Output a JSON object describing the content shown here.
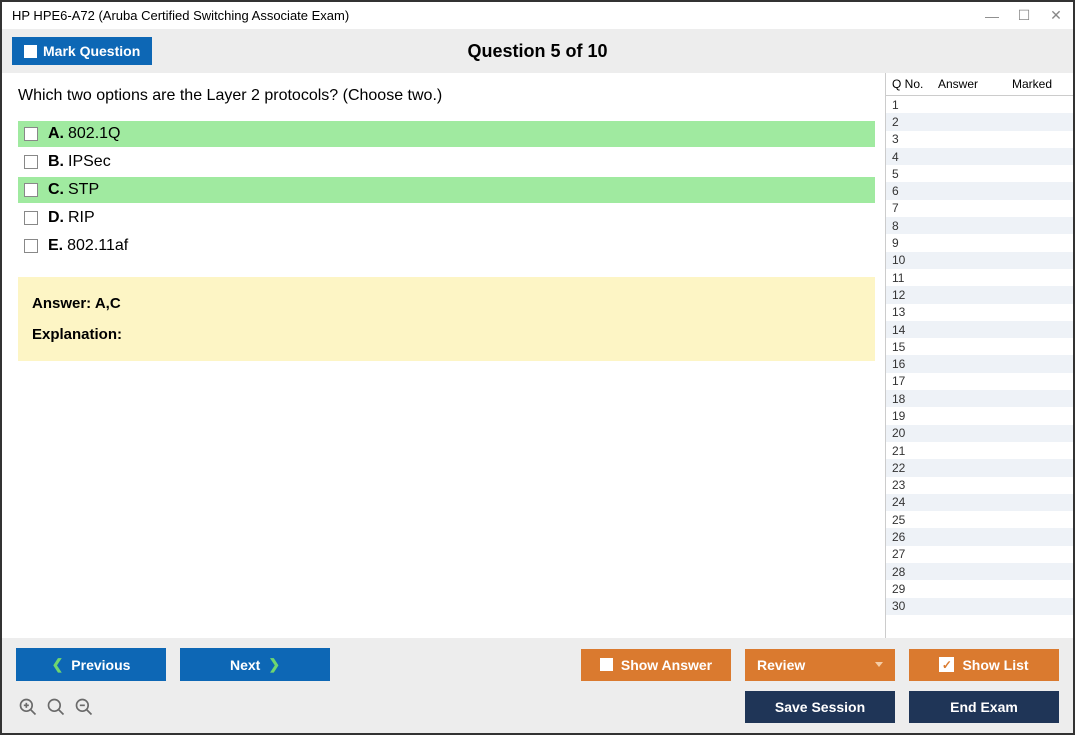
{
  "window": {
    "title": "HP HPE6-A72 (Aruba Certified Switching Associate Exam)"
  },
  "header": {
    "mark_label": "Mark Question",
    "question_title": "Question 5 of 10"
  },
  "question": {
    "text": "Which two options are the Layer 2 protocols? (Choose two.)"
  },
  "options": [
    {
      "letter": "A.",
      "text": "802.1Q",
      "highlighted": true
    },
    {
      "letter": "B.",
      "text": "IPSec",
      "highlighted": false
    },
    {
      "letter": "C.",
      "text": "STP",
      "highlighted": true
    },
    {
      "letter": "D.",
      "text": "RIP",
      "highlighted": false
    },
    {
      "letter": "E.",
      "text": "802.11af",
      "highlighted": false
    }
  ],
  "answer": {
    "label": "Answer:",
    "value": "A,C",
    "explanation_label": "Explanation:"
  },
  "sidebar": {
    "headers": {
      "qno": "Q No.",
      "answer": "Answer",
      "marked": "Marked"
    },
    "rows": [
      1,
      2,
      3,
      4,
      5,
      6,
      7,
      8,
      9,
      10,
      11,
      12,
      13,
      14,
      15,
      16,
      17,
      18,
      19,
      20,
      21,
      22,
      23,
      24,
      25,
      26,
      27,
      28,
      29,
      30
    ]
  },
  "buttons": {
    "previous": "Previous",
    "next": "Next",
    "show_answer": "Show Answer",
    "review": "Review",
    "show_list": "Show List",
    "save_session": "Save Session",
    "end_exam": "End Exam"
  }
}
